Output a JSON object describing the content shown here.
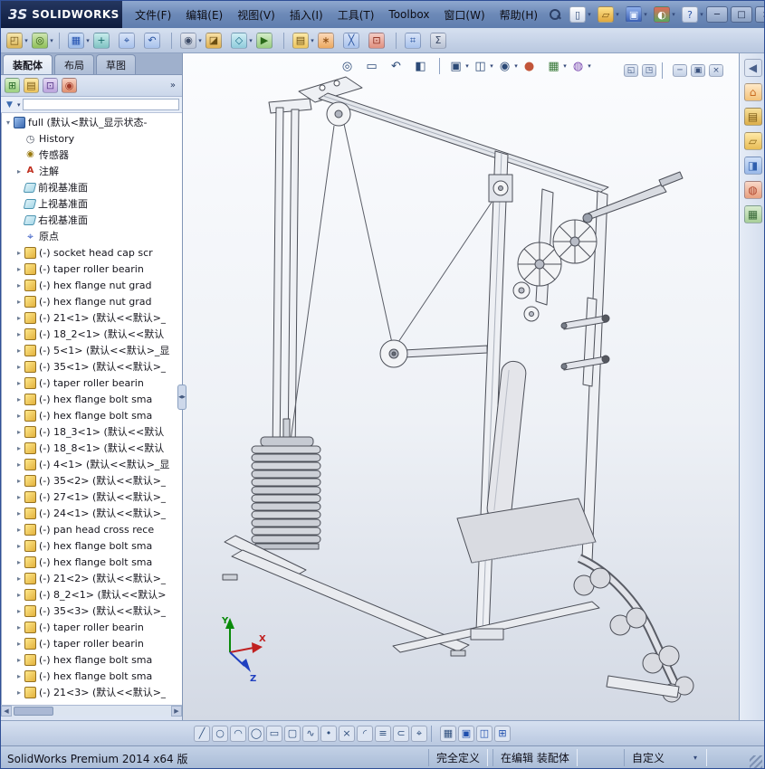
{
  "window": {
    "brand_mark": "3S",
    "brand_name": "SOLIDWORKS",
    "menus": [
      "文件(F)",
      "编辑(E)",
      "视图(V)",
      "插入(I)",
      "工具(T)",
      "Toolbox",
      "窗口(W)",
      "帮助(H)"
    ],
    "title_toolbar": [
      {
        "name": "new-document-icon",
        "glyph": "▯",
        "bg": "linear-gradient(180deg,#ffffff,#cfd9ea)",
        "fg": "#35507c",
        "dd": 1
      },
      {
        "name": "open-icon",
        "glyph": "▱",
        "bg": "linear-gradient(180deg,#ffe28a,#e0a83e)",
        "fg": "#7a5410",
        "dd": 1
      },
      {
        "name": "save-icon",
        "glyph": "▣",
        "bg": "linear-gradient(180deg,#8fb0ec,#3a60b4)",
        "fg": "#e8f0ff",
        "dd": 1
      },
      {
        "name": "options-icon",
        "glyph": "◐",
        "bg": "linear-gradient(180deg,#e06a5a,#58a85e)",
        "fg": "#ffffff",
        "dd": 1
      },
      {
        "name": "help-icon",
        "glyph": "?",
        "bg": "linear-gradient(180deg,#eef2fa,#c8d4ea)",
        "fg": "#2c55a8",
        "dd": 1
      }
    ],
    "win_controls": [
      {
        "name": "window-minimize-button",
        "glyph": "─"
      },
      {
        "name": "window-maximize-button",
        "glyph": "□"
      },
      {
        "name": "window-close-button",
        "glyph": "×"
      }
    ]
  },
  "assembly_toolbar": [
    {
      "name": "insert-components-icon",
      "glyph": "◰",
      "bg": "linear-gradient(180deg,#f7e7ae,#d9b355)",
      "fg": "#6b4e12",
      "dd": 1
    },
    {
      "name": "mate-icon",
      "glyph": "◎",
      "bg": "linear-gradient(180deg,#cfe6b2,#8fbf58)",
      "fg": "#2e5a12",
      "dd": 1
    },
    {
      "name": "toolbar-separator",
      "cls": "sep",
      "inter": "false"
    },
    {
      "name": "linear-component-pattern-icon",
      "glyph": "▦",
      "bg": "linear-gradient(180deg,#cfe0f8,#9ab9e8)",
      "fg": "#1f4fae",
      "dd": 1
    },
    {
      "name": "smart-fasteners-icon",
      "glyph": "+",
      "bg": "linear-gradient(180deg,#c8ecec,#7fc2c2)",
      "fg": "#176a6a"
    },
    {
      "name": "move-component-icon",
      "glyph": "⌖",
      "bg": "linear-gradient(180deg,#d8e4f8,#a8c2ec)",
      "fg": "#25509e"
    },
    {
      "name": "rotate-component-icon",
      "glyph": "↶",
      "bg": "linear-gradient(180deg,#d8e4f8,#a8c2ec)",
      "fg": "#25509e"
    },
    {
      "name": "toolbar-separator",
      "cls": "sep",
      "inter": "false"
    },
    {
      "name": "show-hidden-components-icon",
      "glyph": "◉",
      "bg": "linear-gradient(180deg,#e4e8f0,#b8c2d4)",
      "fg": "#3c4a66",
      "dd": 1
    },
    {
      "name": "assembly-features-icon",
      "glyph": "◪",
      "bg": "linear-gradient(180deg,#f7e0a8,#e0b050)",
      "fg": "#6b4e12"
    },
    {
      "name": "reference-geometry-icon",
      "glyph": "◇",
      "bg": "linear-gradient(180deg,#d0eef4,#90ccdc)",
      "fg": "#1a6a86",
      "dd": 1
    },
    {
      "name": "new-motion-study-icon",
      "glyph": "▶",
      "bg": "linear-gradient(180deg,#d4ecc8,#98cc80)",
      "fg": "#2a6a1a"
    },
    {
      "name": "toolbar-separator",
      "cls": "sep",
      "inter": "false"
    },
    {
      "name": "bill-of-materials-icon",
      "glyph": "▤",
      "bg": "linear-gradient(180deg,#fdeaa8,#ecc45e)",
      "fg": "#6b4e12",
      "dd": 1
    },
    {
      "name": "exploded-view-icon",
      "glyph": "∗",
      "bg": "linear-gradient(180deg,#fcd8b8,#eca860)",
      "fg": "#8a4a10"
    },
    {
      "name": "explode-line-sketch-icon",
      "glyph": "╳",
      "bg": "linear-gradient(180deg,#d8e4f8,#a8c2ec)",
      "fg": "#25509e"
    },
    {
      "name": "interference-detection-icon",
      "glyph": "⊡",
      "bg": "linear-gradient(180deg,#f4ccc4,#e09080)",
      "fg": "#8a2a1a"
    },
    {
      "name": "toolbar-separator",
      "cls": "sep",
      "inter": "false"
    },
    {
      "name": "measure-icon",
      "glyph": "⌗",
      "bg": "linear-gradient(180deg,#d8e4f8,#a8c2ec)",
      "fg": "#25509e"
    },
    {
      "name": "mass-properties-icon",
      "glyph": "Σ",
      "bg": "linear-gradient(180deg,#e4e8f0,#b8c2d4)",
      "fg": "#3c4a66"
    }
  ],
  "tabs": [
    {
      "label": "装配体",
      "cls": "active"
    },
    {
      "label": "布局"
    },
    {
      "label": "草图"
    }
  ],
  "left_panel": {
    "panel_tabs": [
      {
        "name": "featuremanager-tab-icon",
        "glyph": "⊞",
        "bg": "linear-gradient(180deg,#d8f0c8,#9cd080)",
        "fg": "#2a6a2a"
      },
      {
        "name": "propertymanager-tab-icon",
        "glyph": "▤",
        "bg": "linear-gradient(180deg,#fdeaa8,#ecc45e)",
        "fg": "#7a5a16"
      },
      {
        "name": "configurationmanager-tab-icon",
        "glyph": "⊡",
        "bg": "linear-gradient(180deg,#e4d8f4,#bba4dd)",
        "fg": "#5a3a8a"
      },
      {
        "name": "displaymanager-tab-icon",
        "glyph": "◉",
        "bg": "linear-gradient(180deg,#f8d0c0,#e09070)",
        "fg": "#a03a2a"
      }
    ],
    "more_label": "»"
  },
  "feature_tree": {
    "root_label": "full (默认<默认_显示状态-",
    "items": [
      {
        "icon": "i-hist",
        "label": "History"
      },
      {
        "icon": "i-sens",
        "label": "传感器"
      },
      {
        "a": 1,
        "icon": "i-ann",
        "label": "注解"
      },
      {
        "icon": "i-plane",
        "label": "前视基准面"
      },
      {
        "icon": "i-plane",
        "label": "上视基准面"
      },
      {
        "icon": "i-plane",
        "label": "右视基准面"
      },
      {
        "icon": "i-origin",
        "label": "原点"
      },
      {
        "a": 1,
        "icon": "i-part",
        "label": "(-) socket head cap scr"
      },
      {
        "a": 1,
        "icon": "i-part",
        "label": "(-) taper roller bearin"
      },
      {
        "a": 1,
        "icon": "i-part",
        "label": "(-) hex flange nut grad"
      },
      {
        "a": 1,
        "icon": "i-part",
        "label": "(-) hex flange nut grad"
      },
      {
        "a": 1,
        "icon": "i-part",
        "label": "(-) 21<1> (默认<<默认>_"
      },
      {
        "a": 1,
        "icon": "i-part",
        "label": "(-) 18_2<1> (默认<<默认"
      },
      {
        "a": 1,
        "icon": "i-part",
        "label": "(-) 5<1> (默认<<默认>_显"
      },
      {
        "a": 1,
        "icon": "i-part",
        "label": "(-) 35<1> (默认<<默认>_"
      },
      {
        "a": 1,
        "icon": "i-part",
        "label": "(-) taper roller bearin"
      },
      {
        "a": 1,
        "icon": "i-part",
        "label": "(-) hex flange bolt sma"
      },
      {
        "a": 1,
        "icon": "i-part",
        "label": "(-) hex flange bolt sma"
      },
      {
        "a": 1,
        "icon": "i-part",
        "label": "(-) 18_3<1> (默认<<默认"
      },
      {
        "a": 1,
        "icon": "i-part",
        "label": "(-) 18_8<1> (默认<<默认"
      },
      {
        "a": 1,
        "icon": "i-part",
        "label": "(-) 4<1> (默认<<默认>_显"
      },
      {
        "a": 1,
        "icon": "i-part",
        "label": "(-) 35<2> (默认<<默认>_"
      },
      {
        "a": 1,
        "icon": "i-part",
        "label": "(-) 27<1> (默认<<默认>_"
      },
      {
        "a": 1,
        "icon": "i-part",
        "label": "(-) 24<1> (默认<<默认>_"
      },
      {
        "a": 1,
        "icon": "i-part",
        "label": "(-) pan head cross rece"
      },
      {
        "a": 1,
        "icon": "i-part",
        "label": "(-) hex flange bolt sma"
      },
      {
        "a": 1,
        "icon": "i-part",
        "label": "(-) hex flange bolt sma"
      },
      {
        "a": 1,
        "icon": "i-part",
        "label": "(-) 21<2> (默认<<默认>_"
      },
      {
        "a": 1,
        "icon": "i-part",
        "label": "(-) 8_2<1> (默认<<默认>"
      },
      {
        "a": 1,
        "icon": "i-part",
        "label": "(-) 35<3> (默认<<默认>_"
      },
      {
        "a": 1,
        "icon": "i-part",
        "label": "(-) taper roller bearin"
      },
      {
        "a": 1,
        "icon": "i-part",
        "label": "(-) taper roller bearin"
      },
      {
        "a": 1,
        "icon": "i-part",
        "label": "(-) hex flange bolt sma"
      },
      {
        "a": 1,
        "icon": "i-part",
        "label": "(-) hex flange bolt sma"
      },
      {
        "a": 1,
        "icon": "i-part",
        "label": "(-) 21<3> (默认<<默认>_"
      }
    ]
  },
  "heads_up": [
    {
      "name": "zoom-fit-icon",
      "glyph": "◎",
      "fg": "#2c4a77"
    },
    {
      "name": "zoom-area-icon",
      "glyph": "▭",
      "fg": "#2c4a77"
    },
    {
      "name": "previous-view-icon",
      "glyph": "↶",
      "fg": "#2c4a77"
    },
    {
      "name": "section-view-icon",
      "glyph": "◧",
      "fg": "#2c4a77"
    },
    {
      "name": "toolbar-separator",
      "cls": "sep",
      "inter": "false"
    },
    {
      "name": "view-orientation-icon",
      "glyph": "▣",
      "fg": "#2c4a77",
      "dd": 1
    },
    {
      "name": "display-style-icon",
      "glyph": "◫",
      "fg": "#2c4a77",
      "dd": 1
    },
    {
      "name": "hide-show-items-icon",
      "glyph": "◉",
      "fg": "#2c4a77",
      "dd": 1
    },
    {
      "name": "edit-appearance-icon",
      "glyph": "●",
      "fg": "#c2563a"
    },
    {
      "name": "apply-scene-icon",
      "glyph": "▦",
      "fg": "#3a7a3a",
      "dd": 1
    },
    {
      "name": "view-settings-icon",
      "glyph": "◍",
      "fg": "#7a4ab0",
      "dd": 1
    }
  ],
  "doc_controls": [
    {
      "name": "doc-prev-window-icon",
      "glyph": "◱"
    },
    {
      "name": "doc-next-window-icon",
      "glyph": "◳"
    },
    {
      "name": "toolbar-separator",
      "cls": "sep",
      "inter": "false"
    },
    {
      "name": "doc-minimize-icon",
      "glyph": "─"
    },
    {
      "name": "doc-restore-icon",
      "glyph": "▣"
    },
    {
      "name": "doc-close-icon",
      "glyph": "×"
    }
  ],
  "task_pane": [
    {
      "name": "task-pane-collapse-icon",
      "glyph": "◀",
      "bg": "transparent",
      "fg": "#4a618c"
    },
    {
      "name": "home-icon",
      "glyph": "⌂",
      "bg": "linear-gradient(180deg,#ffe9c8,#f3c27a)",
      "fg": "#c96a1e"
    },
    {
      "name": "design-library-icon",
      "glyph": "▤",
      "bg": "linear-gradient(180deg,#f7e09a,#dcae4a)",
      "fg": "#7a5a16"
    },
    {
      "name": "file-explorer-icon",
      "glyph": "▱",
      "bg": "linear-gradient(180deg,#ffe9a8,#e8bc56)",
      "fg": "#8a6412"
    },
    {
      "name": "view-palette-icon",
      "glyph": "◨",
      "bg": "linear-gradient(180deg,#cfe0f8,#9ab9e8)",
      "fg": "#2f5fae"
    },
    {
      "name": "appearances-icon",
      "glyph": "◍",
      "bg": "linear-gradient(180deg,#f8d8c8,#e8a080)",
      "fg": "#b0482f"
    },
    {
      "name": "custom-properties-icon",
      "glyph": "▦",
      "bg": "linear-gradient(180deg,#d8ecd0,#a8cf98)",
      "fg": "#3a6a3a"
    }
  ],
  "sketch_toolbar": [
    {
      "name": "sketch-line-icon",
      "glyph": "╱",
      "fg": "#30507e"
    },
    {
      "name": "sketch-circle-icon",
      "glyph": "○",
      "fg": "#30507e"
    },
    {
      "name": "sketch-arc-icon",
      "glyph": "◠",
      "fg": "#30507e"
    },
    {
      "name": "sketch-ellipse-icon",
      "glyph": "◯",
      "fg": "#30507e"
    },
    {
      "name": "sketch-rectangle-icon",
      "glyph": "▭",
      "fg": "#30507e"
    },
    {
      "name": "sketch-slot-icon",
      "glyph": "▢",
      "fg": "#30507e"
    },
    {
      "name": "sketch-spline-icon",
      "glyph": "∿",
      "fg": "#30507e"
    },
    {
      "name": "sketch-point-icon",
      "glyph": "•",
      "fg": "#30507e"
    },
    {
      "name": "sketch-trim-icon",
      "glyph": "×",
      "fg": "#30507e"
    },
    {
      "name": "sketch-fillet-icon",
      "glyph": "◜",
      "fg": "#30507e"
    },
    {
      "name": "sketch-offset-icon",
      "glyph": "≡",
      "fg": "#30507e"
    },
    {
      "name": "sketch-convert-entities-icon",
      "glyph": "⊂",
      "fg": "#30507e"
    },
    {
      "name": "sketch-dimension-icon",
      "glyph": "⌖",
      "fg": "#30507e"
    },
    {
      "name": "toolbar-separator",
      "cls": "sep",
      "inter": "false"
    },
    {
      "name": "grid-settings-icon",
      "glyph": "▦",
      "fg": "#30507e"
    },
    {
      "name": "viewport-single-icon",
      "glyph": "▣",
      "fg": "#1f4fae"
    },
    {
      "name": "viewport-two-view-icon",
      "glyph": "◫",
      "fg": "#1f4fae"
    },
    {
      "name": "viewport-four-view-icon",
      "glyph": "⊞",
      "fg": "#1f4fae"
    }
  ],
  "viewport": {
    "triad_x": "X",
    "triad_y": "Y",
    "triad_z": "Z"
  },
  "statusbar": {
    "left": "SolidWorks Premium 2014 x64 版",
    "defined": "完全定义",
    "editing": "在编辑 装配体",
    "custom": "自定义"
  }
}
